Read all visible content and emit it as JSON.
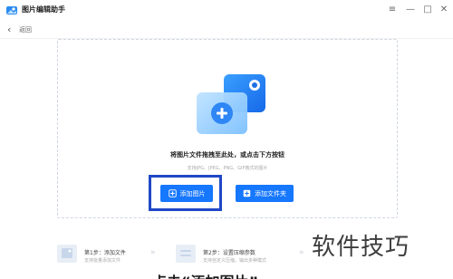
{
  "app": {
    "title": "图片编辑助手",
    "icon": "app-logo-icon"
  },
  "window_controls": {
    "menu": "≡",
    "minimize": "—",
    "maximize": "□",
    "close": "✕"
  },
  "nav": {
    "back_label": "返回"
  },
  "dropzone": {
    "hint_main": "将图片文件拖拽至此处，或点击下方按钮",
    "hint_sub": "支持JPG、JPEG、PNG、GIF格式的图片",
    "add_image_label": "添加图片",
    "add_folder_label": "添加文件夹"
  },
  "steps": [
    {
      "title": "第1步：添加文件",
      "desc": "支持批量添加文件"
    },
    {
      "title": "第2步：设置压缩参数",
      "desc": "支持自定义压缩，输出多种模式"
    }
  ],
  "overlay": {
    "watermark": "软件技巧",
    "bottom_text": "点击“添加图片”"
  },
  "colors": {
    "accent": "#1677ff",
    "highlight": "#1f47c6"
  }
}
